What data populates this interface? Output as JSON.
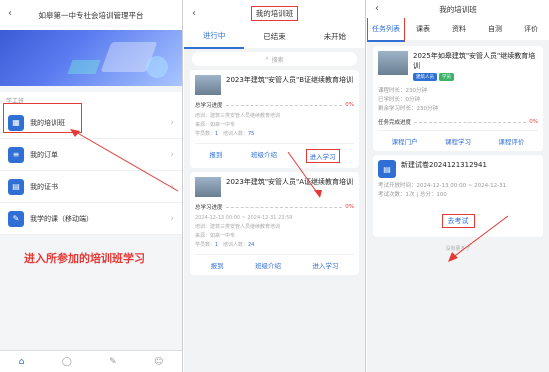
{
  "panel1": {
    "title": "如皋第一中专社会培训管理平台",
    "section_label": "学工班",
    "menu": [
      {
        "label": "我的培训班",
        "icon": "class-icon"
      },
      {
        "label": "我的订单",
        "icon": "order-icon"
      },
      {
        "label": "我的证书",
        "icon": "certificate-icon"
      },
      {
        "label": "我学的课（移动端）",
        "icon": "course-icon"
      }
    ],
    "annotation": "进入所参加的培训班学习",
    "tabbar": [
      "home-icon",
      "chat-icon",
      "edit-icon",
      "user-icon"
    ]
  },
  "panel2": {
    "title": "我的培训班",
    "tabs": [
      "进行中",
      "已结束",
      "未开始"
    ],
    "search_placeholder": "搜索",
    "cards": [
      {
        "title": "2023年建筑\"安管人员\"B证继续教育培训",
        "progress_label": "总学习进度",
        "progress_value": "0%",
        "line1": "培训：建筑三类安管人员继续教育培训",
        "line2": "来源：如皋一中专",
        "count_label": "学员数：",
        "count_a": "1",
        "count_b_label": "培训人数：",
        "count_b": "75",
        "actions": [
          "报到",
          "班级介绍",
          "进入学习"
        ]
      },
      {
        "title": "2023年建筑\"安管人员\"A证继续教育培训",
        "progress_label": "总学习进度",
        "progress_value": "0%",
        "line1": "2024-12-13 00:00 ~ 2024-12-31 23:59",
        "line2": "培训：建筑三类安管人员继续教育培训",
        "line3": "来源：如皋一中专",
        "count_label": "学员数：",
        "count_a": "1",
        "count_b_label": "培训人数：",
        "count_b": "24",
        "actions": [
          "报到",
          "班级介绍",
          "进入学习"
        ]
      }
    ]
  },
  "panel3": {
    "title": "我的培训班",
    "tabs": [
      "任务列表",
      "课表",
      "资料",
      "自测",
      "评价"
    ],
    "card1": {
      "title": "2025年如皋建筑\"安管人员\"继续教育培训",
      "badges": [
        "建筑人员",
        "学员"
      ],
      "lines": [
        "课程时长：230分钟",
        "已学时长：0分钟",
        "剩余学习时长：230分钟"
      ],
      "progress_label": "任务完成进度",
      "progress_value": "0%",
      "actions": [
        "课程门户",
        "课程学习",
        "课程评价"
      ]
    },
    "card2": {
      "title": "新建试卷2024121312941",
      "lines": [
        "考试开放时间：2024-12-13 00:00 ~ 2024-12-31",
        "考试次数：1次 | 总分：100"
      ],
      "action": "去考试"
    },
    "nomore": "没有更多了"
  }
}
